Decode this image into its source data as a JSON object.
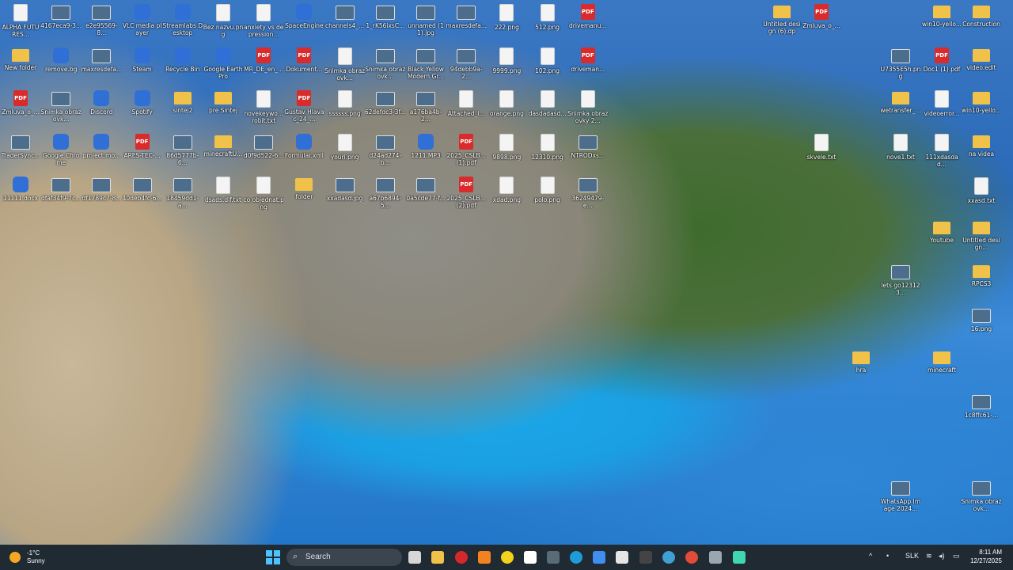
{
  "desktop_icons": [
    {
      "label": "ALPHA FUTURES...",
      "type": "file"
    },
    {
      "label": "4167eca9-3...",
      "type": "img"
    },
    {
      "label": "e2e95569-8...",
      "type": "img"
    },
    {
      "label": "VLC media player",
      "type": "app"
    },
    {
      "label": "Streamlabs Desktop",
      "type": "app"
    },
    {
      "label": "Bez nazvu.png",
      "type": "file"
    },
    {
      "label": "anxiety vs depression...",
      "type": "file"
    },
    {
      "label": "SpaceEngine",
      "type": "app"
    },
    {
      "label": "channels4_...",
      "type": "img"
    },
    {
      "label": "1_rK56ixsC...",
      "type": "img"
    },
    {
      "label": "unnamed (11).jpg",
      "type": "img"
    },
    {
      "label": "maxresdefa...",
      "type": "img"
    },
    {
      "label": "222.png",
      "type": "file"
    },
    {
      "label": "512.png",
      "type": "file"
    },
    {
      "label": "drivemanu...",
      "type": "pdf"
    },
    {
      "label": "New folder",
      "type": "folder"
    },
    {
      "label": "remove.bg",
      "type": "app"
    },
    {
      "label": "maxresdefa...",
      "type": "img"
    },
    {
      "label": "Steam",
      "type": "app"
    },
    {
      "label": "Recycle Bin",
      "type": "app"
    },
    {
      "label": "Google Earth Pro",
      "type": "app"
    },
    {
      "label": "MR_DE_en_...",
      "type": "pdf"
    },
    {
      "label": "Dokument...",
      "type": "pdf"
    },
    {
      "label": "Snimka obrazovk...",
      "type": "file"
    },
    {
      "label": "Snimka obrazovk...",
      "type": "img"
    },
    {
      "label": "Black Yellow Modern Gr...",
      "type": "img"
    },
    {
      "label": "94debb9a-2...",
      "type": "img"
    },
    {
      "label": "9999.png",
      "type": "file"
    },
    {
      "label": "102.png",
      "type": "file"
    },
    {
      "label": "driveman...",
      "type": "pdf"
    },
    {
      "label": "Zmluva_o_...",
      "type": "pdf"
    },
    {
      "label": "Snimka obrazovk...",
      "type": "img"
    },
    {
      "label": "Discord",
      "type": "app"
    },
    {
      "label": "Spotify",
      "type": "app"
    },
    {
      "label": "sintej2",
      "type": "folder"
    },
    {
      "label": "pre Sintej",
      "type": "folder"
    },
    {
      "label": "novekeywo... robit.txt",
      "type": "file"
    },
    {
      "label": "Gustav Hlavac_24_...",
      "type": "pdf"
    },
    {
      "label": "ssssss.png",
      "type": "file"
    },
    {
      "label": "62defdc3-3f...",
      "type": "img"
    },
    {
      "label": "a176ba4b-2...",
      "type": "img"
    },
    {
      "label": "Attached_i...",
      "type": "file"
    },
    {
      "label": "orange.png",
      "type": "file"
    },
    {
      "label": "dasdadasd...",
      "type": "file"
    },
    {
      "label": "Snimka obrazovky 2...",
      "type": "file"
    },
    {
      "label": "TraderSync...",
      "type": "img"
    },
    {
      "label": "Google Chrome",
      "type": "app"
    },
    {
      "label": "project.mo...",
      "type": "app"
    },
    {
      "label": "ARES-TEC-...",
      "type": "pdf"
    },
    {
      "label": "86d5777b-6...",
      "type": "img"
    },
    {
      "label": "minecraftU...",
      "type": "folder"
    },
    {
      "label": "d0f9d522-6...",
      "type": "img"
    },
    {
      "label": "Formular.xml",
      "type": "app"
    },
    {
      "label": "youri.png",
      "type": "file"
    },
    {
      "label": "d24ad274-b...",
      "type": "img"
    },
    {
      "label": "1211.MP3",
      "type": "app"
    },
    {
      "label": "2025_CSLB... (1).pdf",
      "type": "pdf"
    },
    {
      "label": "9898.png",
      "type": "file"
    },
    {
      "label": "12310.png",
      "type": "file"
    },
    {
      "label": "NTRODxs...",
      "type": "img"
    },
    {
      "label": "11111.docx",
      "type": "app"
    },
    {
      "label": "dfaf34f9-7c...",
      "type": "img"
    },
    {
      "label": "df1789c7-8...",
      "type": "img"
    },
    {
      "label": "40deb4fc-6...",
      "type": "img"
    },
    {
      "label": "18459dd1-a...",
      "type": "img"
    },
    {
      "label": "dsads.dif.txt",
      "type": "file"
    },
    {
      "label": "co objednat.png",
      "type": "file"
    },
    {
      "label": "folder",
      "type": "folder"
    },
    {
      "label": "xxadasd.jpg",
      "type": "img"
    },
    {
      "label": "a67b6894-5...",
      "type": "img"
    },
    {
      "label": "0a5cde77-f...",
      "type": "img"
    },
    {
      "label": "2025_CSLB... (2).pdf",
      "type": "pdf"
    },
    {
      "label": "xdad.png",
      "type": "file"
    },
    {
      "label": "polo.png",
      "type": "file"
    },
    {
      "label": "36249479-e...",
      "type": "img"
    }
  ],
  "right_icons": [
    {
      "label": "Untitled design (6).dp",
      "type": "folder"
    },
    {
      "label": "Zmluva_o_...",
      "type": "pdf"
    },
    {
      "label": "win10-yello...",
      "type": "folder"
    },
    {
      "label": "Construction",
      "type": "folder"
    },
    {
      "label": "U7355E5h.png",
      "type": "img"
    },
    {
      "label": "Doc1 (1).pdf",
      "type": "pdf"
    },
    {
      "label": "video.edit",
      "type": "folder"
    },
    {
      "label": "wetransfer_...",
      "type": "folder"
    },
    {
      "label": "videoerror...",
      "type": "file"
    },
    {
      "label": "win10-yello...",
      "type": "folder"
    },
    {
      "label": "skvele.txt",
      "type": "file"
    },
    {
      "label": "nove1.txt",
      "type": "file"
    },
    {
      "label": "111xdasdad...",
      "type": "file"
    },
    {
      "label": "na videa",
      "type": "folder"
    },
    {
      "label": "xxasd.txt",
      "type": "file"
    },
    {
      "label": "Youtube",
      "type": "folder"
    },
    {
      "label": "Untitled design...",
      "type": "folder"
    },
    {
      "label": "lets go123123...",
      "type": "img"
    },
    {
      "label": "RPCS3",
      "type": "folder"
    },
    {
      "label": "16.png",
      "type": "img"
    },
    {
      "label": "hra",
      "type": "folder"
    },
    {
      "label": "minecraft",
      "type": "folder"
    },
    {
      "label": "1c8ffc61-...",
      "type": "img"
    },
    {
      "label": "WhatsApp Image 2024...",
      "type": "img"
    },
    {
      "label": "Snimka obrazovk...",
      "type": "img"
    }
  ],
  "taskbar": {
    "weather_temp": "-1°C",
    "weather_cond": "Sunny",
    "search_placeholder": "Search",
    "language": "SLK",
    "time": "8:11 AM",
    "date": "12/27/2025"
  },
  "colors": {
    "taskbar": "#1f2a33",
    "accent": "#4cc2ff"
  }
}
